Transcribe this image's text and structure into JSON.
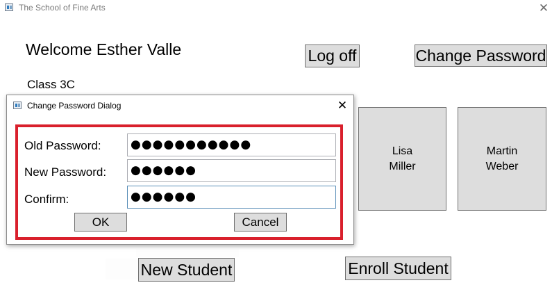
{
  "window": {
    "title": "The School of Fine Arts",
    "close_glyph": "✕"
  },
  "main": {
    "welcome": "Welcome Esther Valle",
    "class_label": "Class 3C",
    "logoff_label": "Log off",
    "change_password_label": "Change Password",
    "new_student_label": "New Student",
    "enroll_student_label": "Enroll Student",
    "students": [
      {
        "first": "Lisa",
        "last": "Miller"
      },
      {
        "first": "Martin",
        "last": "Weber"
      }
    ]
  },
  "dialog": {
    "title": "Change Password Dialog",
    "close_glyph": "✕",
    "highlight_color": "#d9202c",
    "fields": {
      "old_label": "Old Password:",
      "old_value": "●●●●●●●●●●●",
      "new_label": "New Password:",
      "new_value": "●●●●●●",
      "confirm_label": "Confirm:",
      "confirm_value": "●●●●●●"
    },
    "ok_label": "OK",
    "cancel_label": "Cancel"
  }
}
